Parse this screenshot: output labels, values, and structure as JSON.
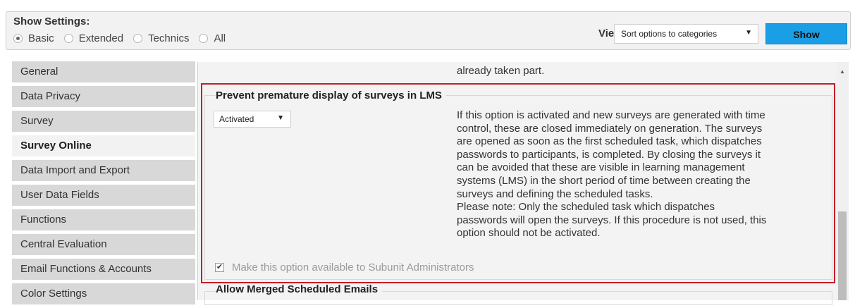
{
  "settings": {
    "title": "Show Settings:",
    "options": [
      "Basic",
      "Extended",
      "Technics",
      "All"
    ],
    "selected": "Basic",
    "view_label": "View:",
    "view_value": "Sort options to categories",
    "show_label": "Show"
  },
  "sidebar": {
    "items": [
      {
        "label": "General"
      },
      {
        "label": "Data Privacy"
      },
      {
        "label": "Survey"
      },
      {
        "label": "Survey Online"
      },
      {
        "label": "Data Import and Export"
      },
      {
        "label": "User Data Fields"
      },
      {
        "label": "Functions"
      },
      {
        "label": "Central Evaluation"
      },
      {
        "label": "Email Functions & Accounts"
      },
      {
        "label": "Color Settings"
      }
    ],
    "active": "Survey Online"
  },
  "content": {
    "top_text": "already taken part.",
    "section": {
      "title": "Prevent premature display of surveys in LMS",
      "select_value": "Activated",
      "description_lines": [
        "If this option is activated and new surveys are generated with time",
        "control, these are closed immediately on generation. The surveys",
        "are opened as soon as the first scheduled task, which dispatches",
        "passwords to participants, is completed. By closing the surveys it",
        "can be avoided that these are visible in learning management",
        "systems (LMS) in the short period of time between creating the",
        "surveys and defining the scheduled tasks.",
        "Please note: Only the scheduled task which dispatches",
        "passwords will open the surveys. If this procedure is not used, this",
        "option should not be activated."
      ],
      "checkbox_label": "Make this option available to Subunit Administrators",
      "checkbox_checked": true
    },
    "next_section_title": "Allow Merged Scheduled Emails"
  },
  "colors": {
    "accent": "#1a9ee6",
    "highlight": "#c0202a"
  }
}
